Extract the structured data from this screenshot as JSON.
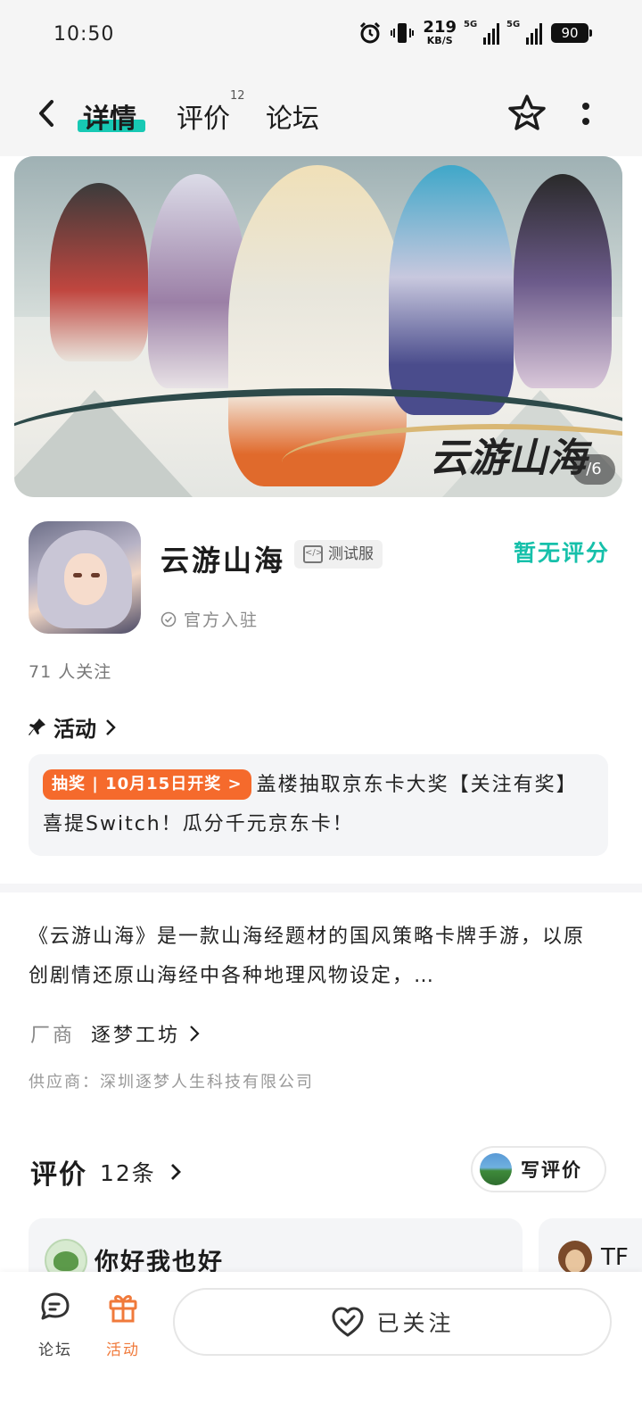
{
  "status_bar": {
    "time": "10:50",
    "net_speed_value": "219",
    "net_speed_unit": "KB/S",
    "sim1": "5G",
    "sim2": "5G",
    "battery": "90"
  },
  "header": {
    "tabs": [
      {
        "label": "详情"
      },
      {
        "label": "评价",
        "badge": "12"
      },
      {
        "label": "论坛"
      }
    ]
  },
  "banner": {
    "logo_text": "云游山海",
    "page_indicator": "/6"
  },
  "app": {
    "name": "云游山海",
    "tag": "测试服",
    "rating_text": "暂无评分",
    "verified_text": "官方入驻",
    "followers": "71 人关注"
  },
  "activity": {
    "heading": "活动",
    "tag": "抽奖 | 10月15日开奖",
    "text": "盖楼抽取京东卡大奖【关注有奖】喜提Switch！瓜分千元京东卡！"
  },
  "description": {
    "text": "《云游山海》是一款山海经题材的国风策略卡牌手游，以原创剧情还原山海经中各种地理风物设定，…",
    "developer_label": "厂商",
    "developer_name": "逐梦工坊",
    "supplier": "供应商：深圳逐梦人生科技有限公司"
  },
  "reviews": {
    "title": "评价",
    "count": "12条",
    "write_button": "写评价",
    "items": [
      {
        "username": "你好我也好"
      },
      {
        "username": "TF"
      }
    ]
  },
  "bottom_nav": {
    "forum_label": "论坛",
    "activity_label": "活动",
    "follow_button": "已关注"
  },
  "colors": {
    "accent_teal": "#16c0aa",
    "accent_orange": "#f56a2c"
  }
}
